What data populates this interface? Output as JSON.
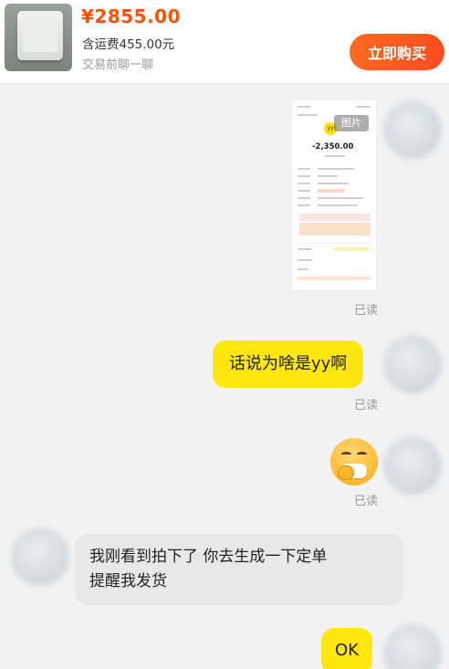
{
  "header": {
    "price": "¥2855.00",
    "shipping": "含运费455.00元",
    "hint": "交易前聊一聊",
    "buy_button": "立即购买"
  },
  "messages": [
    {
      "side": "right",
      "type": "image",
      "badge": "图片",
      "screenshot_amount": "-2,350.00",
      "screenshot_logo": "yy",
      "status": "已读"
    },
    {
      "side": "right",
      "type": "text",
      "text": "话说为啥是yy啊",
      "status": "已读"
    },
    {
      "side": "right",
      "type": "emoji",
      "icon": "face-with-mask-emoji",
      "status": "已读"
    },
    {
      "side": "left",
      "type": "text",
      "line1": "我刚看到拍下了 你去生成一下定单",
      "line2": "提醒我发货"
    },
    {
      "side": "right",
      "type": "text",
      "text": "OK"
    }
  ],
  "colors": {
    "accent": "#ff5000",
    "own_bubble": "#ffe60f",
    "other_bubble": "#e8e8e8",
    "background": "#f2f2f2"
  }
}
